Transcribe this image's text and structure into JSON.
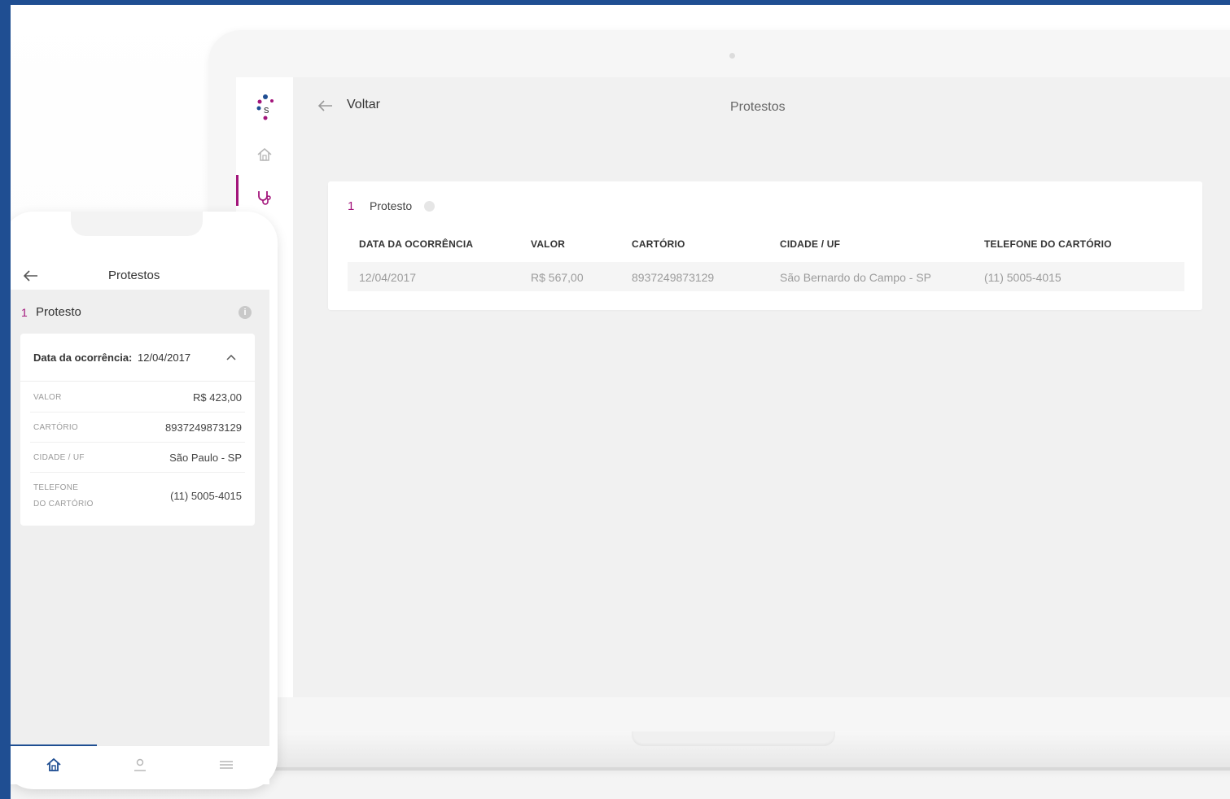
{
  "desktop": {
    "header": {
      "back_label": "Voltar",
      "page_title": "Protestos"
    },
    "card": {
      "count": "1",
      "heading": "Protesto",
      "columns": [
        "DATA DA OCORRÊNCIA",
        "VALOR",
        "CARTÓRIO",
        "CIDADE / UF",
        "TELEFONE DO CARTÓRIO"
      ],
      "rows": [
        [
          "12/04/2017",
          "R$ 567,00",
          "8937249873129",
          "São Bernardo do Campo - SP",
          "(11) 5005-4015"
        ]
      ]
    },
    "sidebar": {
      "icons": [
        "brand-logo",
        "home-icon",
        "stethoscope-icon"
      ]
    }
  },
  "mobile": {
    "header": {
      "page_title": "Protestos"
    },
    "section": {
      "count": "1",
      "heading": "Protesto",
      "info_glyph": "i"
    },
    "card": {
      "date_label": "Data da ocorrência:",
      "date_value": "12/04/2017",
      "rows": [
        {
          "label": "VALOR",
          "value": "R$ 423,00"
        },
        {
          "label": "CARTÓRIO",
          "value": "8937249873129"
        },
        {
          "label": "CIDADE / UF",
          "value": "São Paulo - SP"
        },
        {
          "label_line1": "TELEFONE",
          "label_line2": "DO CARTÓRIO",
          "value": "(11) 5005-4015"
        }
      ]
    },
    "bottom_nav": [
      "home-icon",
      "user-icon",
      "menu-icon"
    ]
  },
  "colors": {
    "accent": "#a3157b",
    "brand_blue": "#1f4e92",
    "background": "#f1f1f1"
  }
}
